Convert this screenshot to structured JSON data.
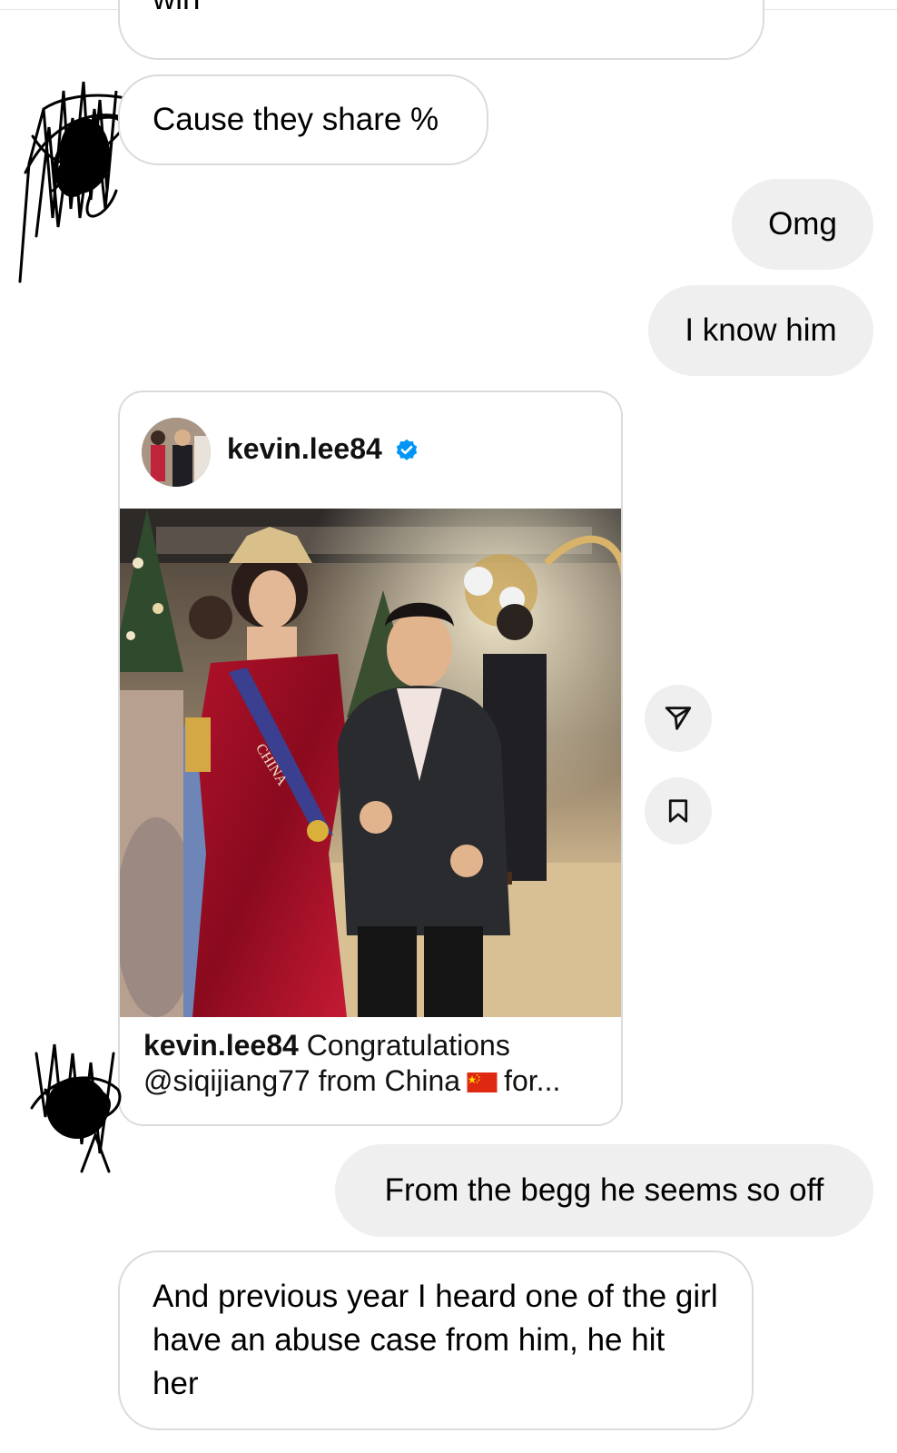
{
  "messages": {
    "partial_top": "win",
    "cause": "Cause they share %",
    "omg": "Omg",
    "know": "I know him",
    "begg": "From the begg he seems so off",
    "abuse": "And previous year I heard one of the girl have an abuse case from him, he hit her"
  },
  "shared_post": {
    "username": "kevin.lee84",
    "caption_user": "kevin.lee84",
    "caption_line1": "Congratulations",
    "caption_line2_start": "@siqijiang77 from China",
    "caption_line2_end": "for...",
    "sash_text": "CHINA",
    "image_alt": "Photo of woman in red gown with sash and tiara next to man in dark suit"
  },
  "icons": {
    "verified": "verified-badge-icon",
    "share": "paper-plane-icon",
    "save": "bookmark-icon",
    "flag": "china-flag-icon"
  },
  "colors": {
    "outgoing_bubble": "#efefef",
    "incoming_border": "#dbdbdb",
    "verified_blue": "#0095f6"
  }
}
